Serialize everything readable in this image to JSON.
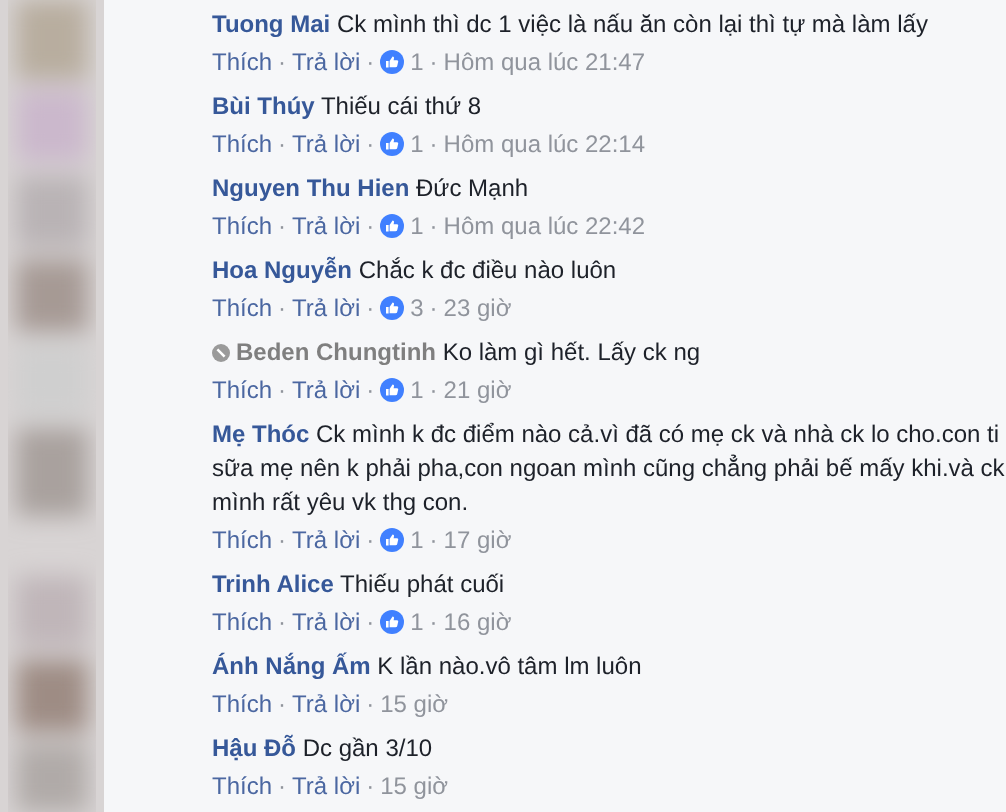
{
  "separator": "·",
  "comments": [
    {
      "inactive": false,
      "text": "**Tuong Mai** Ck mình thì dc 1 việc là nấu ăn còn lại thì tự mà làm lấy",
      "actions": [
        "Thích",
        "Trả lời"
      ],
      "likes": "1",
      "time": "Hôm qua lúc 21:47"
    },
    {
      "inactive": false,
      "text": "**Bùi Thúy** Thiếu cái thứ 8",
      "actions": [
        "Thích",
        "Trả lời"
      ],
      "likes": "1",
      "time": "Hôm qua lúc 22:14"
    },
    {
      "inactive": false,
      "text": "**Nguyen Thu Hien** Đức Mạnh",
      "actions": [
        "Thích",
        "Trả lời"
      ],
      "likes": "1",
      "time": "Hôm qua lúc 22:42"
    },
    {
      "inactive": false,
      "text": "**Hoa Nguyễn** Chắc k đc điều nào luôn",
      "actions": [
        "Thích",
        "Trả lời"
      ],
      "likes": "3",
      "time": "23 giờ"
    },
    {
      "inactive": true,
      "text": "**Beden Chungtinh** Ko làm gì hết. Lấy ck ng",
      "actions": [
        "Thích",
        "Trả lời"
      ],
      "likes": "1",
      "time": "21 giờ"
    },
    {
      "inactive": false,
      "text": "**Mẹ Thóc** Ck mình k đc điểm nào cả.vì đã có mẹ ck và nhà ck lo cho.con ti sữa mẹ nên k phải pha,con ngoan mình cũng chẳng phải bế mấy khi.và ck mình rất yêu vk thg con.",
      "actions": [
        "Thích",
        "Trả lời"
      ],
      "likes": "1",
      "time": "17 giờ"
    },
    {
      "inactive": false,
      "text": "**Trinh Alice** Thiếu phát cuối",
      "actions": [
        "Thích",
        "Trả lời"
      ],
      "likes": "1",
      "time": "16 giờ"
    },
    {
      "inactive": false,
      "text": "**Ánh Nắng Ấm** K lần nào.vô tâm lm luôn",
      "actions": [
        "Thích",
        "Trả lời"
      ],
      "time": "15 giờ"
    },
    {
      "inactive": false,
      "text": "**Hậu Đỗ** Dc gần 3/10",
      "actions": [
        "Thích",
        "Trả lời"
      ],
      "time": "15 giờ"
    }
  ]
}
